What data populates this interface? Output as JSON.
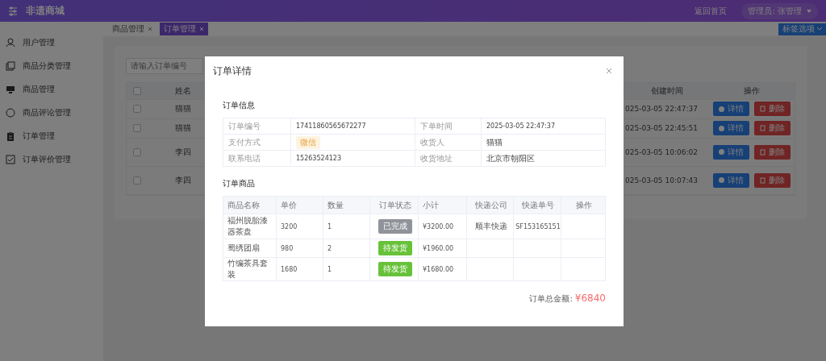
{
  "header": {
    "title": "非遗商城",
    "home_link": "返回首页",
    "user": "管理员: 张管理"
  },
  "sidebar": {
    "items": [
      {
        "label": "用户管理"
      },
      {
        "label": "商品分类管理"
      },
      {
        "label": "商品管理"
      },
      {
        "label": "商品评论管理"
      },
      {
        "label": "订单管理"
      },
      {
        "label": "订单评价管理"
      }
    ]
  },
  "tabs": [
    {
      "label": "商品管理",
      "selected": false
    },
    {
      "label": "订单管理",
      "selected": true
    }
  ],
  "tab_options": "标签选项",
  "search": {
    "placeholder": "请输入订单编号"
  },
  "table": {
    "columns": [
      "姓名",
      "创建时间",
      "操作"
    ],
    "select_all": {
      "checked": false
    },
    "rows": [
      {
        "checked": false,
        "name": "猫猫",
        "time": "025-03-05 22:47:37",
        "actions": [
          "详情",
          "删除"
        ]
      },
      {
        "checked": false,
        "name": "猫猫",
        "time": "025-03-05 22:45:51",
        "actions": [
          "详情",
          "删除"
        ]
      },
      {
        "checked": false,
        "name": "李四",
        "time": "025-03-05 10:06:02",
        "actions": [
          "详情",
          "删除"
        ]
      },
      {
        "checked": false,
        "name": "李四",
        "time": "025-03-05 10:07:43",
        "actions": [
          "详情",
          "删除"
        ]
      }
    ]
  },
  "dialog": {
    "title": "订单详情",
    "info_heading": "订单信息",
    "info": [
      {
        "label": "订单编号",
        "value": "17411860565672277"
      },
      {
        "label": "下单时间",
        "value": "2025-03-05 22:47:37"
      },
      {
        "label": "支付方式",
        "value": "微信",
        "kind": "tag"
      },
      {
        "label": "收货人",
        "value": "猫猫"
      },
      {
        "label": "联系电话",
        "value": "15263524123"
      },
      {
        "label": "收货地址",
        "value": "北京市朝阳区"
      }
    ],
    "goods_heading": "订单商品",
    "goods_columns": [
      "商品名称",
      "单价",
      "数量",
      "订单状态",
      "小计",
      "快递公司",
      "快递单号",
      "操作"
    ],
    "goods": [
      {
        "name": "福州脱胎漆器茶盘",
        "price": "3200",
        "qty": "1",
        "status": "已完成",
        "kind": "completed",
        "subtotal": "¥3200.00",
        "courier": "顺丰快递",
        "tracking": "SF153165151"
      },
      {
        "name": "蜀绣团扇",
        "price": "980",
        "qty": "2",
        "status": "待发货",
        "kind": "pending",
        "subtotal": "¥1960.00"
      },
      {
        "name": "竹编茶具套装",
        "price": "1680",
        "qty": "1",
        "status": "待发货",
        "kind": "pending",
        "subtotal": "¥1680.00"
      }
    ],
    "total_label": "订单总金额:",
    "total": "¥6840"
  }
}
